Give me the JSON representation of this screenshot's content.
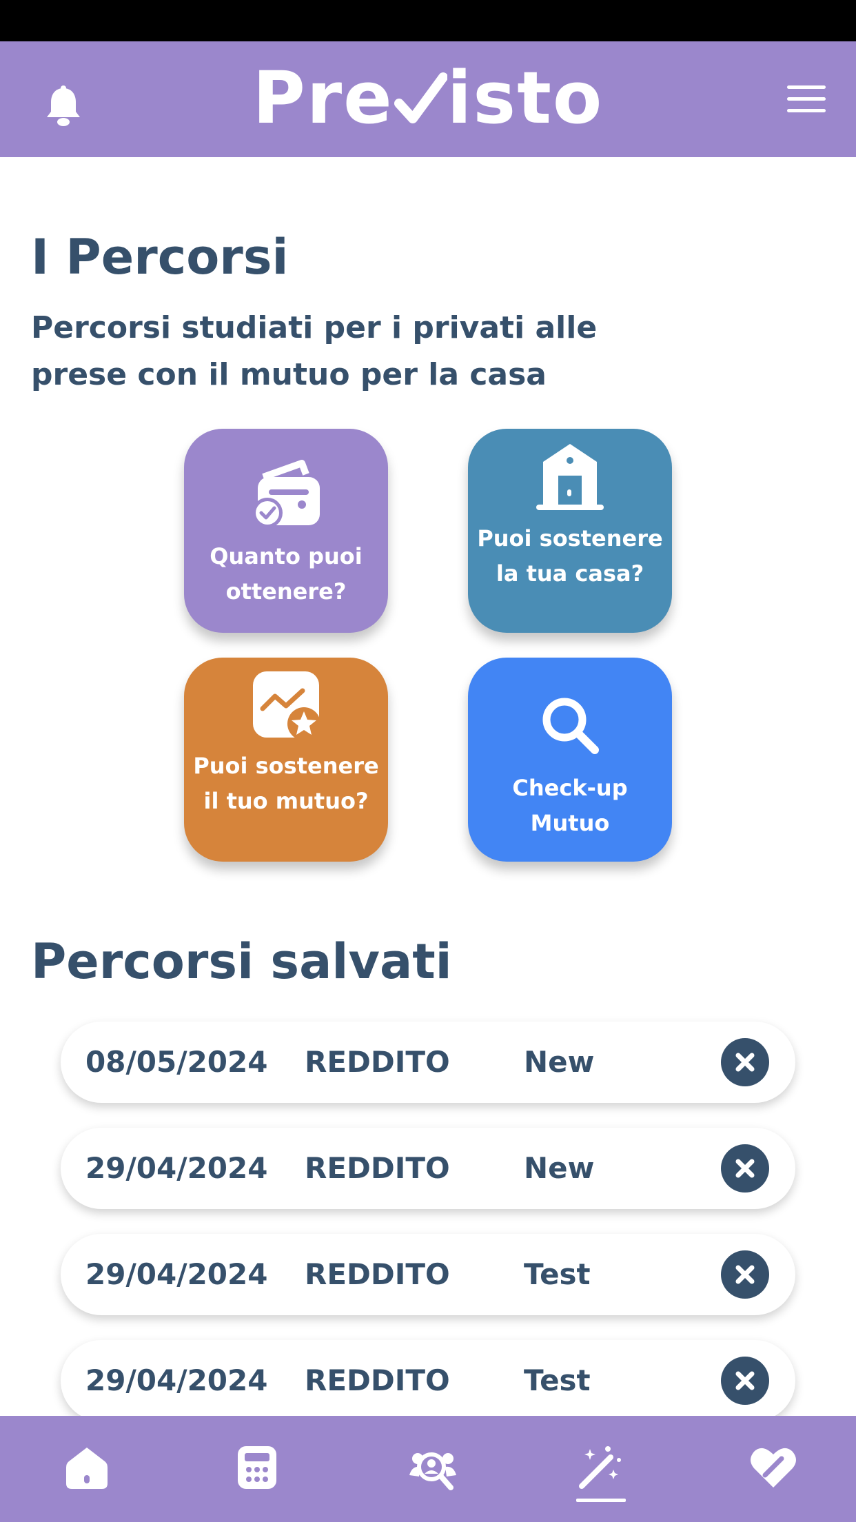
{
  "header": {
    "logo_text_before": "Pre",
    "logo_text_after": "isto",
    "accent_color": "#9b87cc"
  },
  "main": {
    "title": "I Percorsi",
    "subtitle": "Percorsi studiati per i privati alle prese con il mutuo per la casa",
    "tiles": [
      {
        "label": "Quanto puoi ottenere?",
        "icon": "wallet-check-icon",
        "color": "#9b87cc"
      },
      {
        "label": "Puoi sostenere la tua casa?",
        "icon": "house-door-icon",
        "color": "#4a8db5"
      },
      {
        "label": "Puoi sostenere il tuo mutuo?",
        "icon": "chart-star-icon",
        "color": "#d6843b"
      },
      {
        "label": "Check-up Mutuo",
        "icon": "magnifier-icon",
        "color": "#4285f4"
      }
    ]
  },
  "saved": {
    "title": "Percorsi salvati",
    "rows": [
      {
        "date": "08/05/2024",
        "type": "REDDITO",
        "name": "New"
      },
      {
        "date": "29/04/2024",
        "type": "REDDITO",
        "name": "New"
      },
      {
        "date": "29/04/2024",
        "type": "REDDITO",
        "name": "Test"
      },
      {
        "date": "29/04/2024",
        "type": "REDDITO",
        "name": "Test"
      }
    ]
  },
  "bottom_nav": {
    "items": [
      {
        "icon": "home-icon"
      },
      {
        "icon": "calculator-icon"
      },
      {
        "icon": "people-search-icon"
      },
      {
        "icon": "magic-wand-icon",
        "active": true
      },
      {
        "icon": "heart-icon"
      }
    ]
  }
}
